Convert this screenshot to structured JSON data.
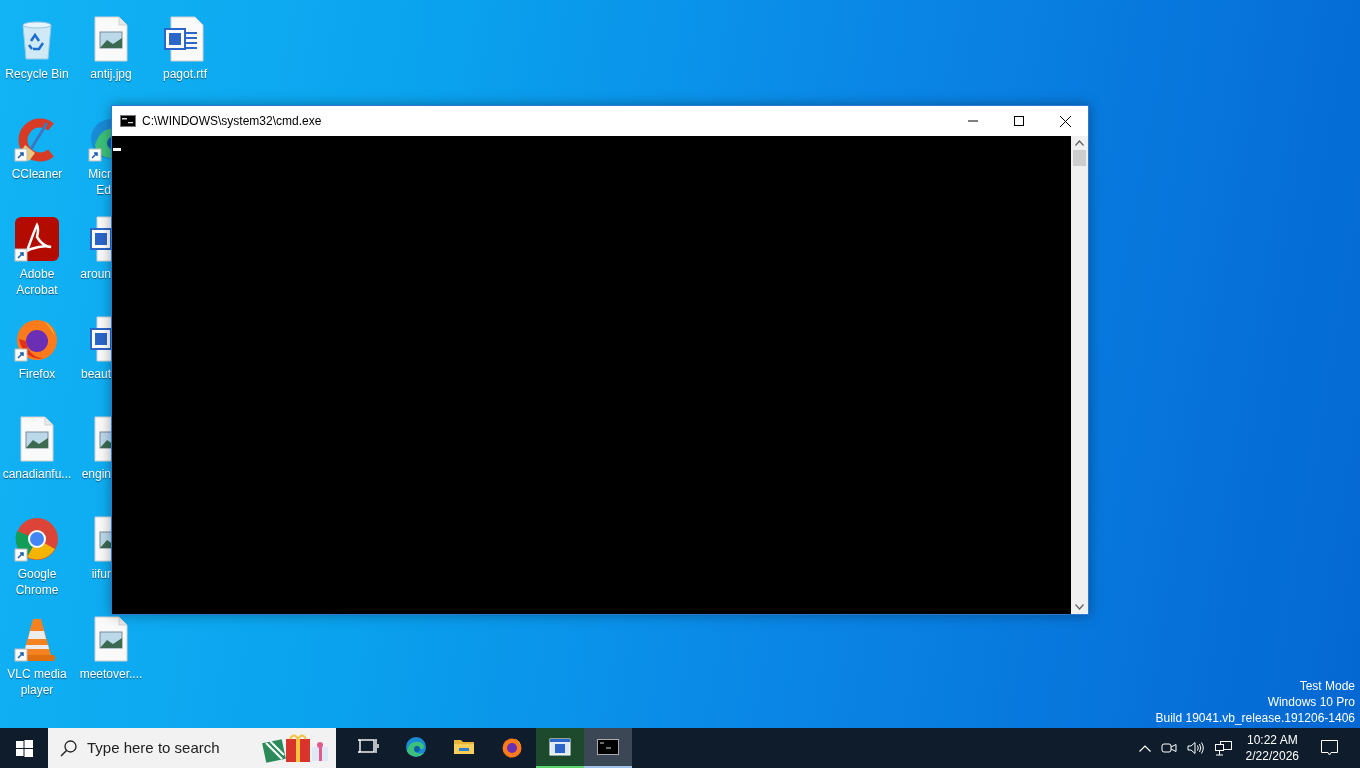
{
  "desktop_icons": [
    {
      "label": "Recycle Bin",
      "kind": "recycle",
      "shortcut": false
    },
    {
      "label": "CCleaner",
      "kind": "ccleaner",
      "shortcut": true
    },
    {
      "label": "Adobe Acrobat",
      "kind": "acrobat",
      "shortcut": true
    },
    {
      "label": "Firefox",
      "kind": "firefox",
      "shortcut": true
    },
    {
      "label": "canadianfu...",
      "kind": "image",
      "shortcut": false
    },
    {
      "label": "Google Chrome",
      "kind": "chrome",
      "shortcut": true
    },
    {
      "label": "VLC media player",
      "kind": "vlc",
      "shortcut": true
    },
    {
      "label": "antij.jpg",
      "kind": "image",
      "shortcut": false
    },
    {
      "label": "Micr Ed",
      "kind": "edge",
      "shortcut": true
    },
    {
      "label": "aroun",
      "kind": "word",
      "shortcut": false
    },
    {
      "label": "beaut",
      "kind": "word",
      "shortcut": false
    },
    {
      "label": "engin",
      "kind": "image",
      "shortcut": false
    },
    {
      "label": "iifur",
      "kind": "image",
      "shortcut": false
    },
    {
      "label": "meetover....",
      "kind": "image",
      "shortcut": false
    },
    {
      "label": "pagot.rtf",
      "kind": "word",
      "shortcut": false
    }
  ],
  "window": {
    "title": "C:\\WINDOWS\\system32\\cmd.exe"
  },
  "desktop_watermark": [
    "Test Mode",
    "Windows 10 Pro",
    "Build 19041.vb_release.191206-1406"
  ],
  "taskbar": {
    "search": {
      "placeholder": "Type here to search"
    },
    "apps": [
      {
        "kind": "taskview",
        "running": false,
        "selected": false
      },
      {
        "kind": "edge",
        "running": false,
        "selected": false
      },
      {
        "kind": "folder",
        "running": false,
        "selected": false
      },
      {
        "kind": "firefox",
        "running": false,
        "selected": false
      },
      {
        "kind": "appwindow",
        "running": true,
        "selected": false
      },
      {
        "kind": "cmd",
        "running": true,
        "selected": true
      }
    ],
    "clock": {
      "time": "10:22 AM",
      "date": "2/22/2026"
    }
  }
}
